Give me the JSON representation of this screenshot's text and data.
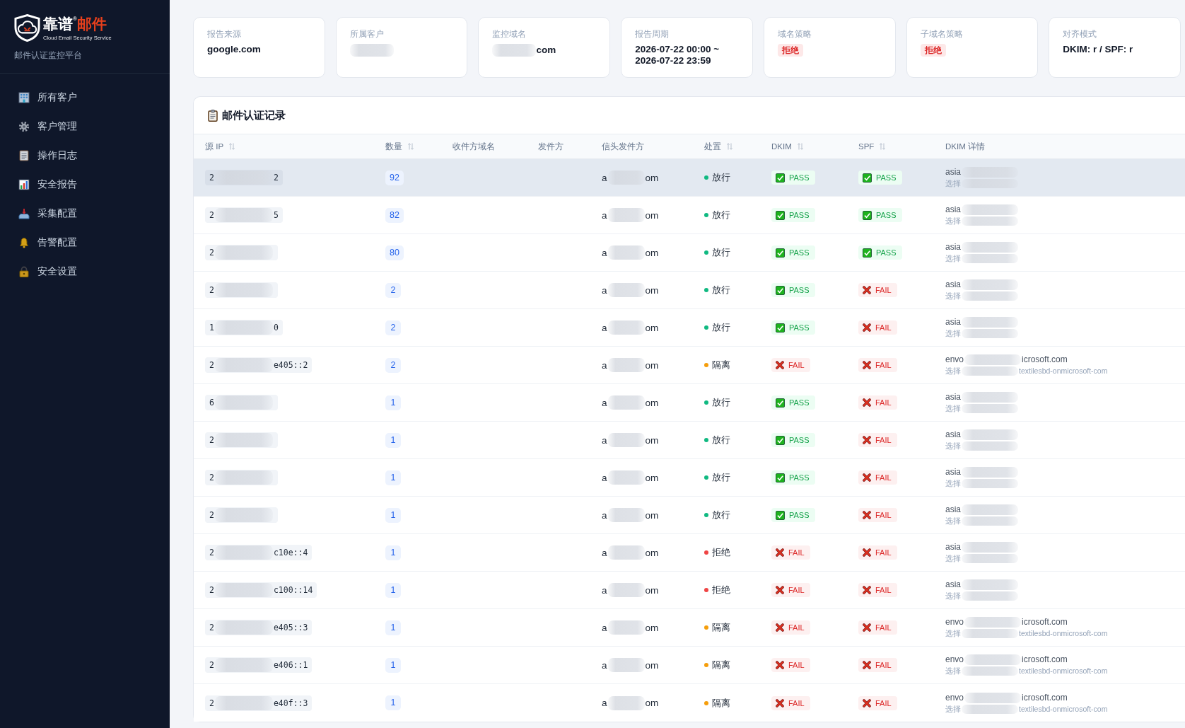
{
  "sidebar": {
    "logo": {
      "brand_main": "靠谱",
      "registered_mark": "®",
      "brand_accent": "邮件",
      "tagline": "Cloud Email Security Service"
    },
    "subtitle": "邮件认证监控平台",
    "items": [
      {
        "label": "所有客户"
      },
      {
        "label": "客户管理"
      },
      {
        "label": "操作日志"
      },
      {
        "label": "安全报告"
      },
      {
        "label": "采集配置"
      },
      {
        "label": "告警配置"
      },
      {
        "label": "安全设置"
      }
    ]
  },
  "summary_cards": [
    {
      "label": "报告来源",
      "kind": "text",
      "value": "google.com"
    },
    {
      "label": "所属客户",
      "kind": "masked"
    },
    {
      "label": "监控域名",
      "kind": "masked",
      "value": "com"
    },
    {
      "label": "报告周期",
      "kind": "text",
      "value": "2026-07-22 00:00 ~ 2026-07-22 23:59"
    },
    {
      "label": "域名策略",
      "kind": "badge",
      "value": "拒绝"
    },
    {
      "label": "子域名策略",
      "kind": "badge",
      "value": "拒绝"
    },
    {
      "label": "对齐模式",
      "kind": "text",
      "value": "DKIM: r / SPF: r"
    }
  ],
  "table": {
    "title": "邮件认证记录",
    "columns": [
      {
        "label": "源 IP",
        "sortable": true
      },
      {
        "label": "数量",
        "sortable": true
      },
      {
        "label": "收件方域名",
        "sortable": false
      },
      {
        "label": "发件方",
        "sortable": false
      },
      {
        "label": "信头发件方",
        "sortable": false
      },
      {
        "label": "处置",
        "sortable": true
      },
      {
        "label": "DKIM",
        "sortable": true
      },
      {
        "label": "SPF",
        "sortable": true
      },
      {
        "label": "DKIM 详情",
        "sortable": false
      }
    ],
    "rows": [
      {
        "hovered": true,
        "source_ip": {
          "prefix": "2",
          "suffix": "2"
        },
        "count": "92",
        "header_from": {
          "prefix": "a",
          "suffix": "om"
        },
        "disposition": {
          "label": "放行",
          "color": "#10b981"
        },
        "dkim": {
          "kind": "pass",
          "label": "PASS"
        },
        "spf": {
          "kind": "pass",
          "label": "PASS"
        },
        "dkim_detail": {
          "line_1": {
            "prefix": "asia"
          },
          "line_2": {
            "prefix": "选择"
          }
        }
      },
      {
        "hovered": false,
        "source_ip": {
          "prefix": "2",
          "suffix": "5"
        },
        "count": "82",
        "header_from": {
          "prefix": "a",
          "suffix": "om"
        },
        "disposition": {
          "label": "放行",
          "color": "#10b981"
        },
        "dkim": {
          "kind": "pass",
          "label": "PASS"
        },
        "spf": {
          "kind": "pass",
          "label": "PASS"
        },
        "dkim_detail": {
          "line_1": {
            "prefix": "asia"
          },
          "line_2": {
            "prefix": "选择"
          }
        }
      },
      {
        "hovered": false,
        "source_ip": {
          "prefix": "2"
        },
        "count": "80",
        "header_from": {
          "prefix": "a",
          "suffix": "om"
        },
        "disposition": {
          "label": "放行",
          "color": "#10b981"
        },
        "dkim": {
          "kind": "pass",
          "label": "PASS"
        },
        "spf": {
          "kind": "pass",
          "label": "PASS"
        },
        "dkim_detail": {
          "line_1": {
            "prefix": "asia"
          },
          "line_2": {
            "prefix": "选择"
          }
        }
      },
      {
        "hovered": false,
        "source_ip": {
          "prefix": "2"
        },
        "count": "2",
        "header_from": {
          "prefix": "a",
          "suffix": "om"
        },
        "disposition": {
          "label": "放行",
          "color": "#10b981"
        },
        "dkim": {
          "kind": "pass",
          "label": "PASS"
        },
        "spf": {
          "kind": "fail",
          "label": "FAIL"
        },
        "dkim_detail": {
          "line_1": {
            "prefix": "asia"
          },
          "line_2": {
            "prefix": "选择"
          }
        }
      },
      {
        "hovered": false,
        "source_ip": {
          "prefix": "1",
          "suffix": "0"
        },
        "count": "2",
        "header_from": {
          "prefix": "a",
          "suffix": "om"
        },
        "disposition": {
          "label": "放行",
          "color": "#10b981"
        },
        "dkim": {
          "kind": "pass",
          "label": "PASS"
        },
        "spf": {
          "kind": "fail",
          "label": "FAIL"
        },
        "dkim_detail": {
          "line_1": {
            "prefix": "asia"
          },
          "line_2": {
            "prefix": "选择"
          }
        }
      },
      {
        "hovered": false,
        "source_ip": {
          "prefix": "2",
          "suffix": "e405::2"
        },
        "count": "2",
        "header_from": {
          "prefix": "a",
          "suffix": "om"
        },
        "disposition": {
          "label": "隔离",
          "color": "#f59e0b"
        },
        "dkim": {
          "kind": "fail",
          "label": "FAIL"
        },
        "spf": {
          "kind": "fail",
          "label": "FAIL"
        },
        "dkim_detail": {
          "line_1": {
            "prefix": "envo",
            "suffix": "icrosoft.com"
          },
          "line_2": {
            "prefix": "选择",
            "suffix": "textilesbd-onmicrosoft-com"
          }
        }
      },
      {
        "hovered": false,
        "source_ip": {
          "prefix": "6"
        },
        "count": "1",
        "header_from": {
          "prefix": "a",
          "suffix": "om"
        },
        "disposition": {
          "label": "放行",
          "color": "#10b981"
        },
        "dkim": {
          "kind": "pass",
          "label": "PASS"
        },
        "spf": {
          "kind": "fail",
          "label": "FAIL"
        },
        "dkim_detail": {
          "line_1": {
            "prefix": "asia"
          },
          "line_2": {
            "prefix": "选择"
          }
        }
      },
      {
        "hovered": false,
        "source_ip": {
          "prefix": "2"
        },
        "count": "1",
        "header_from": {
          "prefix": "a",
          "suffix": "om"
        },
        "disposition": {
          "label": "放行",
          "color": "#10b981"
        },
        "dkim": {
          "kind": "pass",
          "label": "PASS"
        },
        "spf": {
          "kind": "fail",
          "label": "FAIL"
        },
        "dkim_detail": {
          "line_1": {
            "prefix": "asia"
          },
          "line_2": {
            "prefix": "选择"
          }
        }
      },
      {
        "hovered": false,
        "source_ip": {
          "prefix": "2"
        },
        "count": "1",
        "header_from": {
          "prefix": "a",
          "suffix": "om"
        },
        "disposition": {
          "label": "放行",
          "color": "#10b981"
        },
        "dkim": {
          "kind": "pass",
          "label": "PASS"
        },
        "spf": {
          "kind": "fail",
          "label": "FAIL"
        },
        "dkim_detail": {
          "line_1": {
            "prefix": "asia"
          },
          "line_2": {
            "prefix": "选择"
          }
        }
      },
      {
        "hovered": false,
        "source_ip": {
          "prefix": "2"
        },
        "count": "1",
        "header_from": {
          "prefix": "a",
          "suffix": "om"
        },
        "disposition": {
          "label": "放行",
          "color": "#10b981"
        },
        "dkim": {
          "kind": "pass",
          "label": "PASS"
        },
        "spf": {
          "kind": "fail",
          "label": "FAIL"
        },
        "dkim_detail": {
          "line_1": {
            "prefix": "asia"
          },
          "line_2": {
            "prefix": "选择"
          }
        }
      },
      {
        "hovered": false,
        "source_ip": {
          "prefix": "2",
          "suffix": "c10e::4"
        },
        "count": "1",
        "header_from": {
          "prefix": "a",
          "suffix": "om"
        },
        "disposition": {
          "label": "拒绝",
          "color": "#ef4444"
        },
        "dkim": {
          "kind": "fail",
          "label": "FAIL"
        },
        "spf": {
          "kind": "fail",
          "label": "FAIL"
        },
        "dkim_detail": {
          "line_1": {
            "prefix": "asia"
          },
          "line_2": {
            "prefix": "选择"
          }
        }
      },
      {
        "hovered": false,
        "source_ip": {
          "prefix": "2",
          "suffix": "c100::14"
        },
        "count": "1",
        "header_from": {
          "prefix": "a",
          "suffix": "om"
        },
        "disposition": {
          "label": "拒绝",
          "color": "#ef4444"
        },
        "dkim": {
          "kind": "fail",
          "label": "FAIL"
        },
        "spf": {
          "kind": "fail",
          "label": "FAIL"
        },
        "dkim_detail": {
          "line_1": {
            "prefix": "asia"
          },
          "line_2": {
            "prefix": "选择"
          }
        }
      },
      {
        "hovered": false,
        "source_ip": {
          "prefix": "2",
          "suffix": "e405::3"
        },
        "count": "1",
        "header_from": {
          "prefix": "a",
          "suffix": "om"
        },
        "disposition": {
          "label": "隔离",
          "color": "#f59e0b"
        },
        "dkim": {
          "kind": "fail",
          "label": "FAIL"
        },
        "spf": {
          "kind": "fail",
          "label": "FAIL"
        },
        "dkim_detail": {
          "line_1": {
            "prefix": "envo",
            "suffix": "icrosoft.com"
          },
          "line_2": {
            "prefix": "选择",
            "suffix": "textilesbd-onmicrosoft-com"
          }
        }
      },
      {
        "hovered": false,
        "source_ip": {
          "prefix": "2",
          "suffix": "e406::1"
        },
        "count": "1",
        "header_from": {
          "prefix": "a",
          "suffix": "om"
        },
        "disposition": {
          "label": "隔离",
          "color": "#f59e0b"
        },
        "dkim": {
          "kind": "fail",
          "label": "FAIL"
        },
        "spf": {
          "kind": "fail",
          "label": "FAIL"
        },
        "dkim_detail": {
          "line_1": {
            "prefix": "envo",
            "suffix": "icrosoft.com"
          },
          "line_2": {
            "prefix": "选择",
            "suffix": "textilesbd-onmicrosoft-com"
          }
        }
      },
      {
        "hovered": false,
        "source_ip": {
          "prefix": "2",
          "suffix": "e40f::3"
        },
        "count": "1",
        "header_from": {
          "prefix": "a",
          "suffix": "om"
        },
        "disposition": {
          "label": "隔离",
          "color": "#f59e0b"
        },
        "dkim": {
          "kind": "fail",
          "label": "FAIL"
        },
        "spf": {
          "kind": "fail",
          "label": "FAIL"
        },
        "dkim_detail": {
          "line_1": {
            "prefix": "envo",
            "suffix": "icrosoft.com"
          },
          "line_2": {
            "prefix": "选择",
            "suffix": "textilesbd-onmicrosoft-com"
          }
        }
      }
    ]
  }
}
